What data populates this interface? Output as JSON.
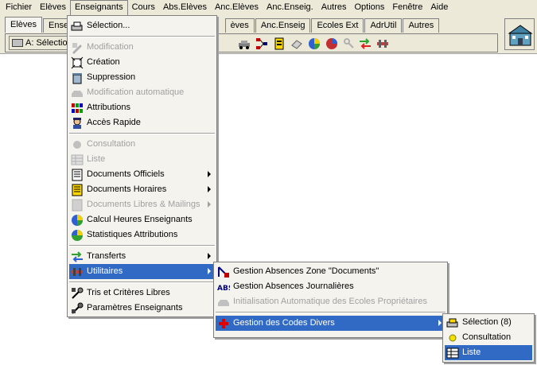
{
  "menubar": [
    "Fichier",
    "Elèves",
    "Enseignants",
    "Cours",
    "Abs.Elèves",
    "Anc.Elèves",
    "Anc.Enseig.",
    "Autres",
    "Options",
    "Fenêtre",
    "Aide"
  ],
  "toolbar": {
    "tabs": [
      "Elèves",
      "Ensei",
      "èves",
      "Anc.Enseig",
      "Ecoles Ext",
      "AdrUtil",
      "Autres"
    ],
    "combo_value": "A: Sélectio"
  },
  "enseignants_menu": {
    "items": [
      {
        "label": "Sélection...",
        "icon": "selection-icon",
        "disabled": false
      },
      {
        "label": "Modification",
        "icon": "modification-icon",
        "disabled": true
      },
      {
        "label": "Création",
        "icon": "creation-icon",
        "disabled": false
      },
      {
        "label": "Suppression",
        "icon": "trash-icon",
        "disabled": false
      },
      {
        "label": "Modification automatique",
        "icon": "auto-modification-icon",
        "disabled": true
      },
      {
        "label": "Attributions",
        "icon": "attributions-icon",
        "disabled": false
      },
      {
        "label": "Accès Rapide",
        "icon": "quick-access-icon",
        "disabled": false
      },
      {
        "label": "Consultation",
        "icon": "consultation-icon",
        "disabled": true
      },
      {
        "label": "Liste",
        "icon": "list-icon",
        "disabled": true
      },
      {
        "label": "Documents Officiels",
        "icon": "documents-icon",
        "disabled": false,
        "submenu": true
      },
      {
        "label": "Documents Horaires",
        "icon": "schedule-documents-icon",
        "disabled": false,
        "submenu": true
      },
      {
        "label": "Documents Libres & Mailings",
        "icon": "mailings-icon",
        "disabled": true,
        "submenu": true
      },
      {
        "label": "Calcul Heures Enseignants",
        "icon": "pie-chart-icon",
        "disabled": false
      },
      {
        "label": "Statistiques Attributions",
        "icon": "statistics-icon",
        "disabled": false
      },
      {
        "label": "Transferts",
        "icon": "transfer-arrows-icon",
        "disabled": false,
        "submenu": true
      },
      {
        "label": "Utilitaires",
        "icon": "utilities-icon",
        "disabled": false,
        "submenu": true,
        "highlighted": true
      },
      {
        "label": "Tris et Critères Libres",
        "icon": "sort-icon",
        "disabled": false
      },
      {
        "label": "Paramètres Enseignants",
        "icon": "parameters-icon",
        "disabled": false
      }
    ]
  },
  "utilitaires_menu": {
    "items": [
      {
        "label": "Gestion Absences Zone \"Documents\"",
        "icon": "absences-zone-icon",
        "disabled": false
      },
      {
        "label": "Gestion Absences Journalières",
        "icon": "abs-icon",
        "disabled": false
      },
      {
        "label": "Initialisation Automatique des Ecoles Propriétaires",
        "icon": "init-icon",
        "disabled": true
      },
      {
        "label": "Gestion des Codes Divers",
        "icon": "red-cross-icon",
        "disabled": false,
        "submenu": true,
        "highlighted": true
      }
    ]
  },
  "codes_menu": {
    "items": [
      {
        "label": "Sélection (8)",
        "icon": "selection-icon",
        "disabled": false
      },
      {
        "label": "Consultation",
        "icon": "yellow-dot-icon",
        "disabled": false
      },
      {
        "label": "Liste",
        "icon": "list-icon",
        "disabled": false,
        "highlighted": true
      }
    ]
  }
}
